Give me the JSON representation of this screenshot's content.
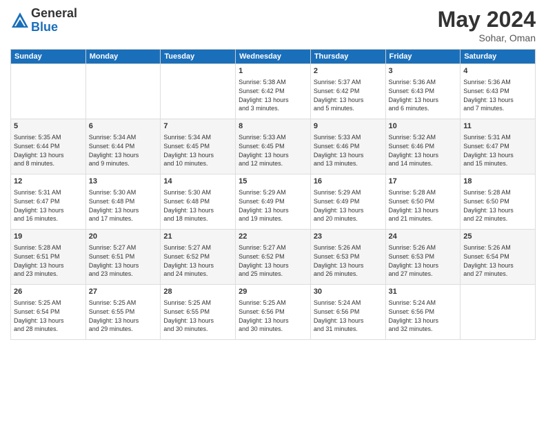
{
  "header": {
    "logo_general": "General",
    "logo_blue": "Blue",
    "month_year": "May 2024",
    "location": "Sohar, Oman"
  },
  "days_of_week": [
    "Sunday",
    "Monday",
    "Tuesday",
    "Wednesday",
    "Thursday",
    "Friday",
    "Saturday"
  ],
  "weeks": [
    [
      {
        "day": "",
        "info": ""
      },
      {
        "day": "",
        "info": ""
      },
      {
        "day": "",
        "info": ""
      },
      {
        "day": "1",
        "info": "Sunrise: 5:38 AM\nSunset: 6:42 PM\nDaylight: 13 hours\nand 3 minutes."
      },
      {
        "day": "2",
        "info": "Sunrise: 5:37 AM\nSunset: 6:42 PM\nDaylight: 13 hours\nand 5 minutes."
      },
      {
        "day": "3",
        "info": "Sunrise: 5:36 AM\nSunset: 6:43 PM\nDaylight: 13 hours\nand 6 minutes."
      },
      {
        "day": "4",
        "info": "Sunrise: 5:36 AM\nSunset: 6:43 PM\nDaylight: 13 hours\nand 7 minutes."
      }
    ],
    [
      {
        "day": "5",
        "info": "Sunrise: 5:35 AM\nSunset: 6:44 PM\nDaylight: 13 hours\nand 8 minutes."
      },
      {
        "day": "6",
        "info": "Sunrise: 5:34 AM\nSunset: 6:44 PM\nDaylight: 13 hours\nand 9 minutes."
      },
      {
        "day": "7",
        "info": "Sunrise: 5:34 AM\nSunset: 6:45 PM\nDaylight: 13 hours\nand 10 minutes."
      },
      {
        "day": "8",
        "info": "Sunrise: 5:33 AM\nSunset: 6:45 PM\nDaylight: 13 hours\nand 12 minutes."
      },
      {
        "day": "9",
        "info": "Sunrise: 5:33 AM\nSunset: 6:46 PM\nDaylight: 13 hours\nand 13 minutes."
      },
      {
        "day": "10",
        "info": "Sunrise: 5:32 AM\nSunset: 6:46 PM\nDaylight: 13 hours\nand 14 minutes."
      },
      {
        "day": "11",
        "info": "Sunrise: 5:31 AM\nSunset: 6:47 PM\nDaylight: 13 hours\nand 15 minutes."
      }
    ],
    [
      {
        "day": "12",
        "info": "Sunrise: 5:31 AM\nSunset: 6:47 PM\nDaylight: 13 hours\nand 16 minutes."
      },
      {
        "day": "13",
        "info": "Sunrise: 5:30 AM\nSunset: 6:48 PM\nDaylight: 13 hours\nand 17 minutes."
      },
      {
        "day": "14",
        "info": "Sunrise: 5:30 AM\nSunset: 6:48 PM\nDaylight: 13 hours\nand 18 minutes."
      },
      {
        "day": "15",
        "info": "Sunrise: 5:29 AM\nSunset: 6:49 PM\nDaylight: 13 hours\nand 19 minutes."
      },
      {
        "day": "16",
        "info": "Sunrise: 5:29 AM\nSunset: 6:49 PM\nDaylight: 13 hours\nand 20 minutes."
      },
      {
        "day": "17",
        "info": "Sunrise: 5:28 AM\nSunset: 6:50 PM\nDaylight: 13 hours\nand 21 minutes."
      },
      {
        "day": "18",
        "info": "Sunrise: 5:28 AM\nSunset: 6:50 PM\nDaylight: 13 hours\nand 22 minutes."
      }
    ],
    [
      {
        "day": "19",
        "info": "Sunrise: 5:28 AM\nSunset: 6:51 PM\nDaylight: 13 hours\nand 23 minutes."
      },
      {
        "day": "20",
        "info": "Sunrise: 5:27 AM\nSunset: 6:51 PM\nDaylight: 13 hours\nand 23 minutes."
      },
      {
        "day": "21",
        "info": "Sunrise: 5:27 AM\nSunset: 6:52 PM\nDaylight: 13 hours\nand 24 minutes."
      },
      {
        "day": "22",
        "info": "Sunrise: 5:27 AM\nSunset: 6:52 PM\nDaylight: 13 hours\nand 25 minutes."
      },
      {
        "day": "23",
        "info": "Sunrise: 5:26 AM\nSunset: 6:53 PM\nDaylight: 13 hours\nand 26 minutes."
      },
      {
        "day": "24",
        "info": "Sunrise: 5:26 AM\nSunset: 6:53 PM\nDaylight: 13 hours\nand 27 minutes."
      },
      {
        "day": "25",
        "info": "Sunrise: 5:26 AM\nSunset: 6:54 PM\nDaylight: 13 hours\nand 27 minutes."
      }
    ],
    [
      {
        "day": "26",
        "info": "Sunrise: 5:25 AM\nSunset: 6:54 PM\nDaylight: 13 hours\nand 28 minutes."
      },
      {
        "day": "27",
        "info": "Sunrise: 5:25 AM\nSunset: 6:55 PM\nDaylight: 13 hours\nand 29 minutes."
      },
      {
        "day": "28",
        "info": "Sunrise: 5:25 AM\nSunset: 6:55 PM\nDaylight: 13 hours\nand 30 minutes."
      },
      {
        "day": "29",
        "info": "Sunrise: 5:25 AM\nSunset: 6:56 PM\nDaylight: 13 hours\nand 30 minutes."
      },
      {
        "day": "30",
        "info": "Sunrise: 5:24 AM\nSunset: 6:56 PM\nDaylight: 13 hours\nand 31 minutes."
      },
      {
        "day": "31",
        "info": "Sunrise: 5:24 AM\nSunset: 6:56 PM\nDaylight: 13 hours\nand 32 minutes."
      },
      {
        "day": "",
        "info": ""
      }
    ]
  ]
}
